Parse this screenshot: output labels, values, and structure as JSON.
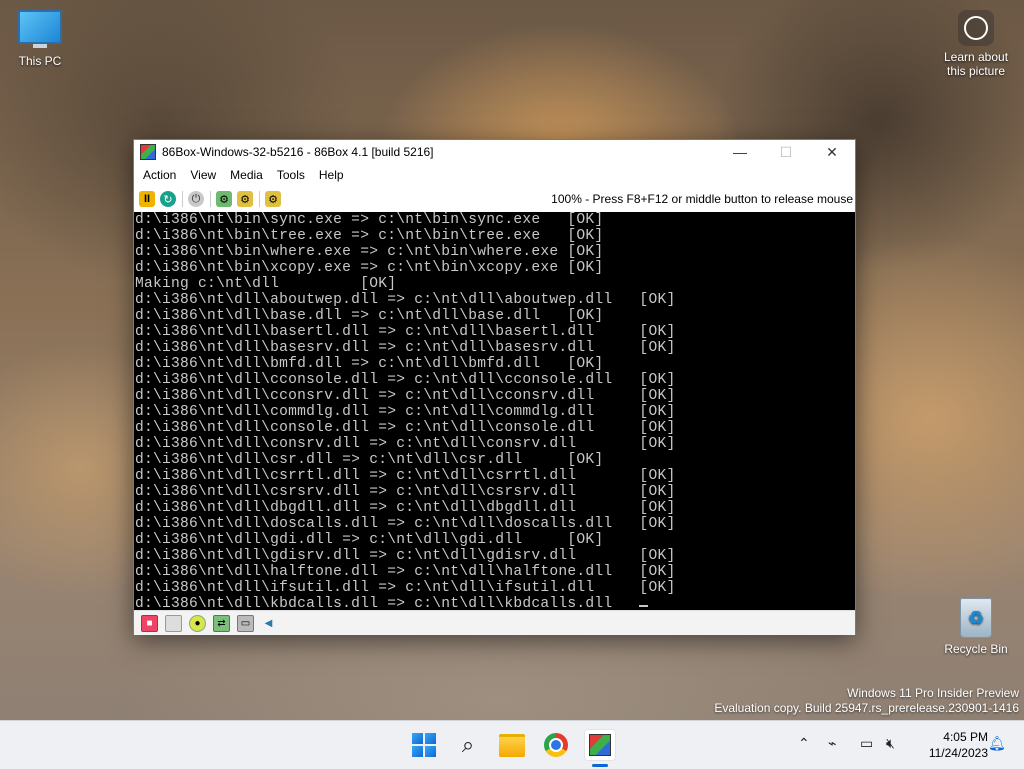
{
  "desktop": {
    "this_pc_label": "This PC",
    "learn_label_1": "Learn about",
    "learn_label_2": "this picture",
    "recycle_label": "Recycle Bin",
    "watermark_line1": "Windows 11 Pro Insider Preview",
    "watermark_line2": "Evaluation copy. Build 25947.rs_prerelease.230901-1416"
  },
  "window": {
    "title": "86Box-Windows-32-b5216 - 86Box 4.1 [build 5216]",
    "controls": {
      "minimize": "—",
      "maximize": "☐",
      "close": "✕"
    },
    "menu": [
      "Action",
      "View",
      "Media",
      "Tools",
      "Help"
    ],
    "toolbar_status": "100% - Press F8+F12 or middle button to release mouse"
  },
  "terminal": {
    "lines": [
      "d:\\i386\\nt\\bin\\sync.exe => c:\\nt\\bin\\sync.exe   [OK]",
      "d:\\i386\\nt\\bin\\tree.exe => c:\\nt\\bin\\tree.exe   [OK]",
      "d:\\i386\\nt\\bin\\where.exe => c:\\nt\\bin\\where.exe [OK]",
      "d:\\i386\\nt\\bin\\xcopy.exe => c:\\nt\\bin\\xcopy.exe [OK]",
      "Making c:\\nt\\dll         [OK]",
      "d:\\i386\\nt\\dll\\aboutwep.dll => c:\\nt\\dll\\aboutwep.dll   [OK]",
      "d:\\i386\\nt\\dll\\base.dll => c:\\nt\\dll\\base.dll   [OK]",
      "d:\\i386\\nt\\dll\\basertl.dll => c:\\nt\\dll\\basertl.dll     [OK]",
      "d:\\i386\\nt\\dll\\basesrv.dll => c:\\nt\\dll\\basesrv.dll     [OK]",
      "d:\\i386\\nt\\dll\\bmfd.dll => c:\\nt\\dll\\bmfd.dll   [OK]",
      "d:\\i386\\nt\\dll\\cconsole.dll => c:\\nt\\dll\\cconsole.dll   [OK]",
      "d:\\i386\\nt\\dll\\cconsrv.dll => c:\\nt\\dll\\cconsrv.dll     [OK]",
      "d:\\i386\\nt\\dll\\commdlg.dll => c:\\nt\\dll\\commdlg.dll     [OK]",
      "d:\\i386\\nt\\dll\\console.dll => c:\\nt\\dll\\console.dll     [OK]",
      "d:\\i386\\nt\\dll\\consrv.dll => c:\\nt\\dll\\consrv.dll       [OK]",
      "d:\\i386\\nt\\dll\\csr.dll => c:\\nt\\dll\\csr.dll     [OK]",
      "d:\\i386\\nt\\dll\\csrrtl.dll => c:\\nt\\dll\\csrrtl.dll       [OK]",
      "d:\\i386\\nt\\dll\\csrsrv.dll => c:\\nt\\dll\\csrsrv.dll       [OK]",
      "d:\\i386\\nt\\dll\\dbgdll.dll => c:\\nt\\dll\\dbgdll.dll       [OK]",
      "d:\\i386\\nt\\dll\\doscalls.dll => c:\\nt\\dll\\doscalls.dll   [OK]",
      "d:\\i386\\nt\\dll\\gdi.dll => c:\\nt\\dll\\gdi.dll     [OK]",
      "d:\\i386\\nt\\dll\\gdisrv.dll => c:\\nt\\dll\\gdisrv.dll       [OK]",
      "d:\\i386\\nt\\dll\\halftone.dll => c:\\nt\\dll\\halftone.dll   [OK]",
      "d:\\i386\\nt\\dll\\ifsutil.dll => c:\\nt\\dll\\ifsutil.dll     [OK]",
      "d:\\i386\\nt\\dll\\kbdcalls.dll => c:\\nt\\dll\\kbdcalls.dll   "
    ]
  },
  "taskbar": {
    "clock_time": "4:05 PM",
    "clock_date": "11/24/2023"
  },
  "colors": {
    "terminal_bg": "#000000",
    "terminal_fg": "#c8c8c8",
    "accent": "#0b68d6"
  }
}
